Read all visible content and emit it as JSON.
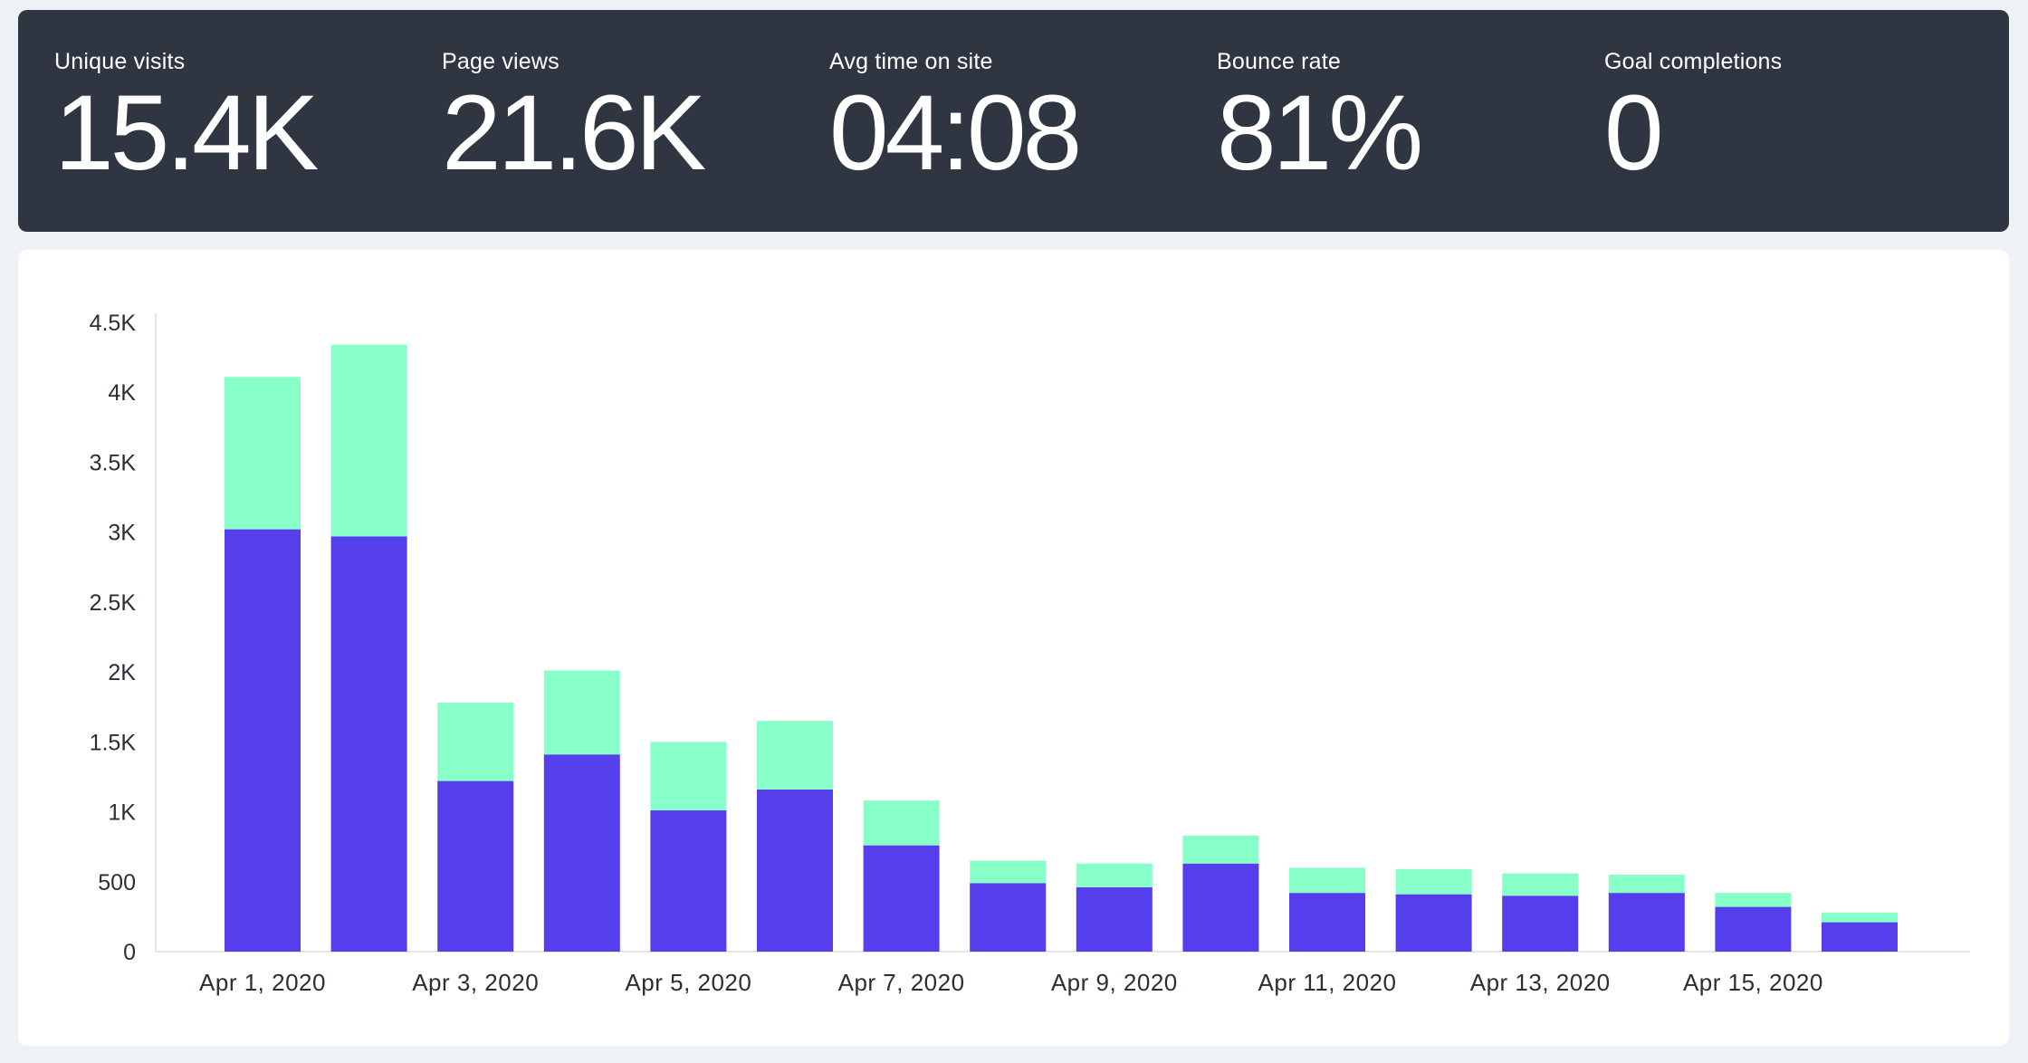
{
  "stats": [
    {
      "label": "Unique visits",
      "value": "15.4K"
    },
    {
      "label": "Page views",
      "value": "21.6K"
    },
    {
      "label": "Avg time on site",
      "value": "04:08"
    },
    {
      "label": "Bounce rate",
      "value": "81%"
    },
    {
      "label": "Goal completions",
      "value": "0"
    }
  ],
  "chart_data": {
    "type": "bar",
    "stacked": true,
    "categories": [
      "Apr 1, 2020",
      "Apr 2, 2020",
      "Apr 3, 2020",
      "Apr 4, 2020",
      "Apr 5, 2020",
      "Apr 6, 2020",
      "Apr 7, 2020",
      "Apr 8, 2020",
      "Apr 9, 2020",
      "Apr 10, 2020",
      "Apr 11, 2020",
      "Apr 12, 2020",
      "Apr 13, 2020",
      "Apr 14, 2020",
      "Apr 15, 2020",
      "Apr 16, 2020"
    ],
    "x_tick_labels": [
      "Apr 1, 2020",
      "Apr 3, 2020",
      "Apr 5, 2020",
      "Apr 7, 2020",
      "Apr 9, 2020",
      "Apr 11, 2020",
      "Apr 13, 2020",
      "Apr 15, 2020"
    ],
    "series": [
      {
        "color": "#553fec",
        "values": [
          3020,
          2970,
          1220,
          1410,
          1010,
          1160,
          760,
          490,
          460,
          630,
          420,
          410,
          400,
          420,
          320,
          210
        ]
      },
      {
        "color": "#88ffc8",
        "values": [
          1090,
          1370,
          560,
          600,
          490,
          490,
          320,
          160,
          170,
          200,
          180,
          180,
          160,
          130,
          100,
          70
        ]
      }
    ],
    "y_ticks": [
      0,
      500,
      1000,
      1500,
      2000,
      2500,
      3000,
      3500,
      4000,
      4500
    ],
    "y_tick_labels": [
      "0",
      "500",
      "1K",
      "1.5K",
      "2K",
      "2.5K",
      "3K",
      "3.5K",
      "4K",
      "4.5K"
    ],
    "ylim": [
      0,
      4500
    ],
    "grid": false,
    "legend": "none",
    "title": "",
    "xlabel": "",
    "ylabel": ""
  }
}
